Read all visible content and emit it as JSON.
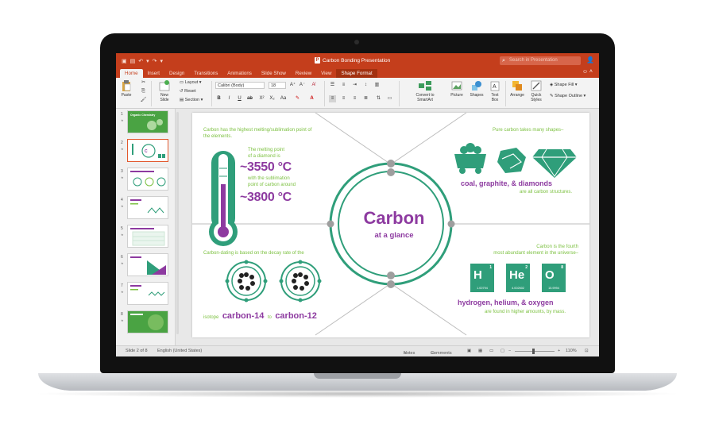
{
  "app": {
    "doc_title": "Carbon Bonding Presentation",
    "search_placeholder": "Search in Presentation",
    "colors": {
      "accent": "#c43e1c",
      "teal": "#2f9e7a",
      "purple": "#8d3aa0",
      "green": "#7dc142"
    }
  },
  "tabs": [
    {
      "label": "Home"
    },
    {
      "label": "Insert"
    },
    {
      "label": "Design"
    },
    {
      "label": "Transitions"
    },
    {
      "label": "Animations"
    },
    {
      "label": "Slide Show"
    },
    {
      "label": "Review"
    },
    {
      "label": "View"
    },
    {
      "label": "Shape Format"
    }
  ],
  "ribbon": {
    "paste": "Paste",
    "new_slide_1": "New",
    "new_slide_2": "Slide",
    "layout": "Layout",
    "reset": "Reset",
    "section": "Section",
    "font_name": "Calibri (Body)",
    "font_size": "18",
    "convert_1": "Convert to",
    "convert_2": "SmartArt",
    "picture": "Picture",
    "shapes": "Shapes",
    "textbox_1": "Text",
    "textbox_2": "Box",
    "arrange": "Arrange",
    "quick_styles_1": "Quick",
    "quick_styles_2": "Styles",
    "shape_fill": "Shape Fill",
    "shape_outline": "Shape Outline"
  },
  "thumbnails": [
    {
      "num": "1",
      "title": "Organic Chemistry"
    },
    {
      "num": "2",
      "title": ""
    },
    {
      "num": "3",
      "title": ""
    },
    {
      "num": "4",
      "title": ""
    },
    {
      "num": "5",
      "title": ""
    },
    {
      "num": "6",
      "title": ""
    },
    {
      "num": "7",
      "title": ""
    },
    {
      "num": "8",
      "title": ""
    }
  ],
  "slide": {
    "center_title": "Carbon",
    "center_sub": "at a glance",
    "tl_line1": "Carbon has the highest melting/sublimation point of",
    "tl_line2": "the elements.",
    "melt_1": "The melting point",
    "melt_2": "of a diamond is",
    "temp1": "~3550 °C",
    "sub_1": "with the sublimation",
    "sub_2": "point of carbon around",
    "temp2": "~3800 °C",
    "tr_line": "Pure carbon takes many shapes–",
    "shapes_bold": "coal, graphite, & diamonds",
    "shapes_after": "are all carbon structures.",
    "bl_line": "Carbon-dating is based on the decay rate of the",
    "isotope_pre": "isotope",
    "isotope_a": "carbon-14",
    "isotope_mid": "to",
    "isotope_b": "carbon-12",
    "br_line1": "Carbon is the fourth",
    "br_line2": "most abundant element in the universe–",
    "elements_bold": "hydrogen, helium, & oxygen",
    "elements_after": "are found in higher amounts, by mass.",
    "tiles": [
      {
        "sym": "H",
        "num": "1",
        "mass": "1.00794"
      },
      {
        "sym": "He",
        "num": "2",
        "mass": "4.002602"
      },
      {
        "sym": "O",
        "num": "8",
        "mass": "15.9994"
      }
    ]
  },
  "status": {
    "slide_of": "Slide 2 of 8",
    "language": "English (United States)",
    "notes": "Notes",
    "comments": "Comments",
    "zoom": "110%"
  }
}
